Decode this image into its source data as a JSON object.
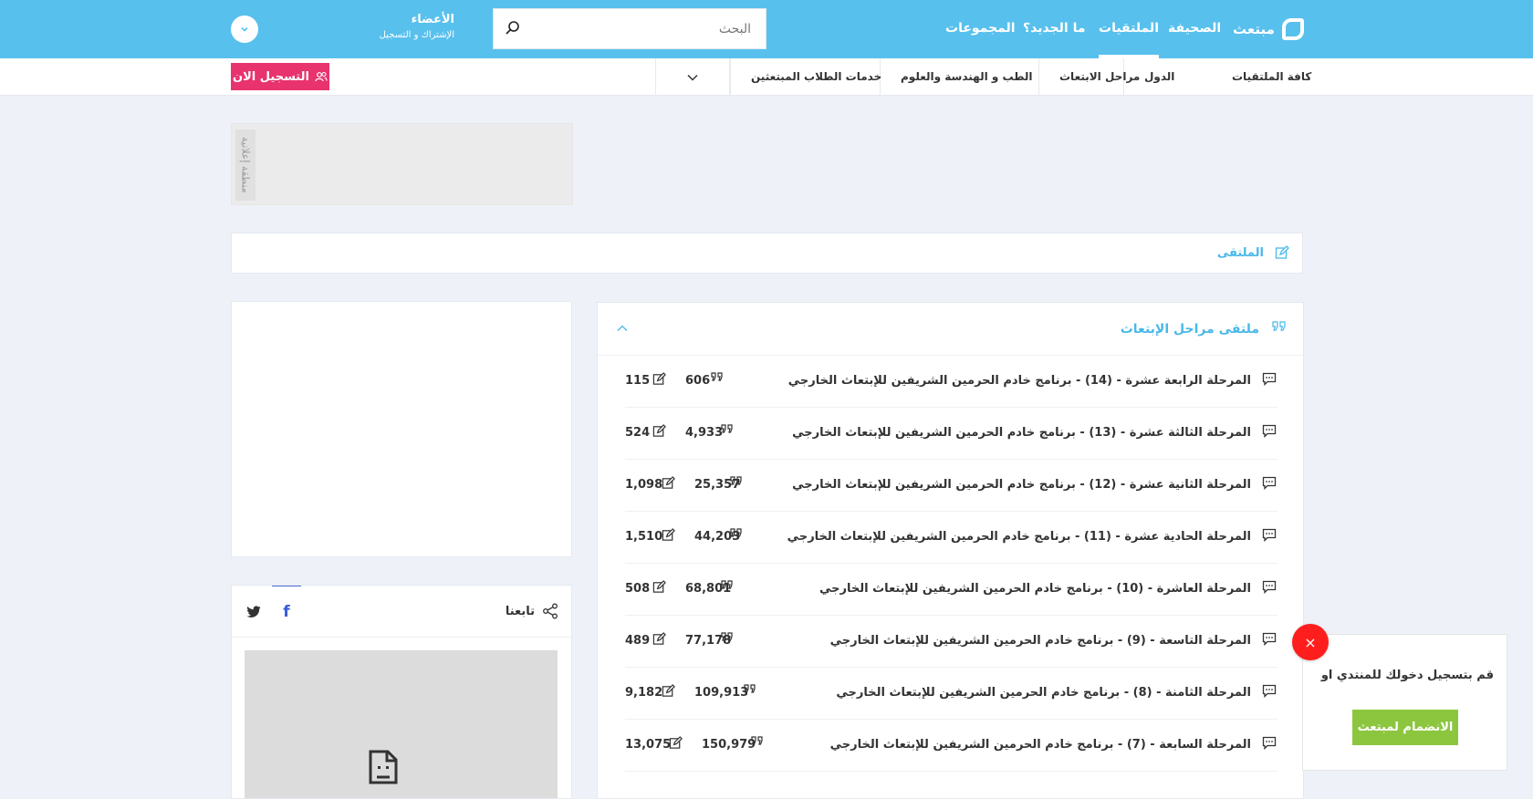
{
  "header": {
    "logo_text": "مبتعث",
    "nav": [
      "الصحيفة",
      "الملتقيات",
      "ما الجديد؟",
      "المجموعات"
    ],
    "active_nav": "الملتقيات",
    "search_placeholder": "البحث",
    "members_title": "الأعضاء",
    "members_subtitle": "الإشتراك و التسجيل"
  },
  "subnav": {
    "items": [
      "كافة الملتقيات",
      "الدول",
      "مراحل الابتعاث",
      "الطب و الهندسة والعلوم",
      "خدمات الطلاب المبتعثين"
    ],
    "register_label": "التسجيل الان"
  },
  "ad": {
    "label": "منطقة إعلانية"
  },
  "breadcrumb": {
    "label": "الملتقى"
  },
  "forum": {
    "title": "ملتقى مراحل الإبتعاث",
    "rows": [
      {
        "title": "المرحلة الرابعة عشرة - (14) - برنامج خادم الحرمين الشريفين للإبتعاث الخارجي",
        "posts": "606",
        "threads": "115"
      },
      {
        "title": "المرحلة الثالثة عشرة - (13) - برنامج خادم الحرمين الشريفين للإبتعاث الخارجي",
        "posts": "4,933",
        "threads": "524"
      },
      {
        "title": "المرحلة الثانية عشرة - (12) - برنامج خادم الحرمين الشريفين للإبتعاث الخارجي",
        "posts": "25,357",
        "threads": "1,098"
      },
      {
        "title": "المرحلة الحادية عشرة - (11) - برنامج خادم الحرمين الشريفين للإبتعاث الخارجي",
        "posts": "44,203",
        "threads": "1,510"
      },
      {
        "title": "المرحلة العاشرة - (10) - برنامج خادم الحرمين الشريفين للإبتعاث الخارجي",
        "posts": "68,801",
        "threads": "508"
      },
      {
        "title": "المرحلة التاسعة - (9) - برنامج خادم الحرمين الشريفين للإبتعاث الخارجي",
        "posts": "77,178",
        "threads": "489"
      },
      {
        "title": "المرحلة الثامنة - (8) - برنامج خادم الحرمين الشريفين للإبتعاث الخارجي",
        "posts": "109,913",
        "threads": "9,182"
      },
      {
        "title": "المرحلة السابعة - (7) - برنامج خادم الحرمين الشريفين للإبتعاث الخارجي",
        "posts": "150,979",
        "threads": "13,075"
      }
    ]
  },
  "follow": {
    "title": "تابعنا",
    "facebook_label": "f"
  },
  "popup": {
    "message": "قم بتسجيل دخولك للمنتدي او",
    "join_label": "الانضمام لمبتعث",
    "close_label": "×"
  },
  "colors": {
    "header": "#58c0ed",
    "accent": "#4ab8e8",
    "register": "#e8336f",
    "join": "#8cc63f",
    "close": "#ff1e1e"
  }
}
